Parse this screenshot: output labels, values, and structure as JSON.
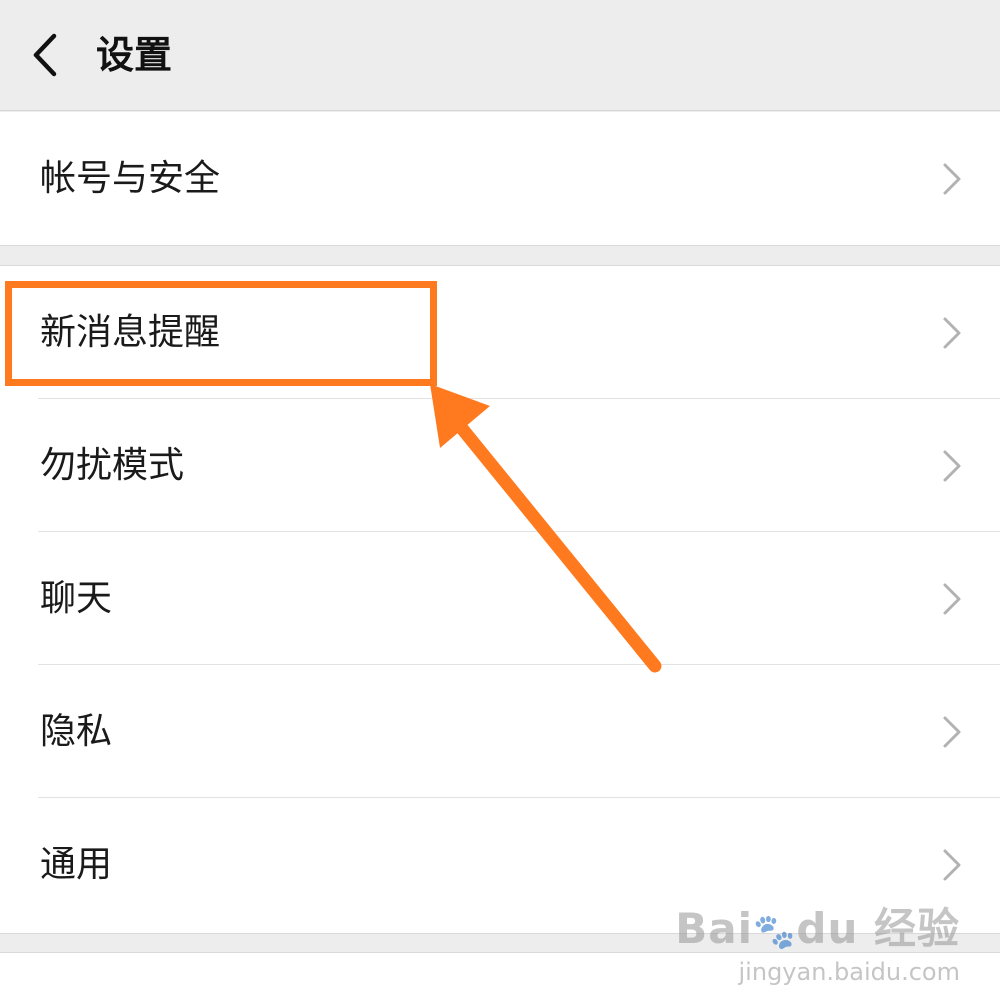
{
  "header": {
    "title": "设置"
  },
  "groups": [
    {
      "items": [
        {
          "label": "帐号与安全"
        }
      ]
    },
    {
      "items": [
        {
          "label": "新消息提醒"
        },
        {
          "label": "勿扰模式"
        },
        {
          "label": "聊天"
        },
        {
          "label": "隐私"
        },
        {
          "label": "通用"
        }
      ]
    }
  ],
  "annotation": {
    "color": "#ff7a1f",
    "target": "新消息提醒"
  },
  "watermark": {
    "brand_left": "Bai",
    "brand_right": "du",
    "brand_suffix": "经验",
    "url": "jingyan.baidu.com"
  },
  "icons": {
    "back": "chevron-left-icon",
    "row": "chevron-right-icon"
  }
}
